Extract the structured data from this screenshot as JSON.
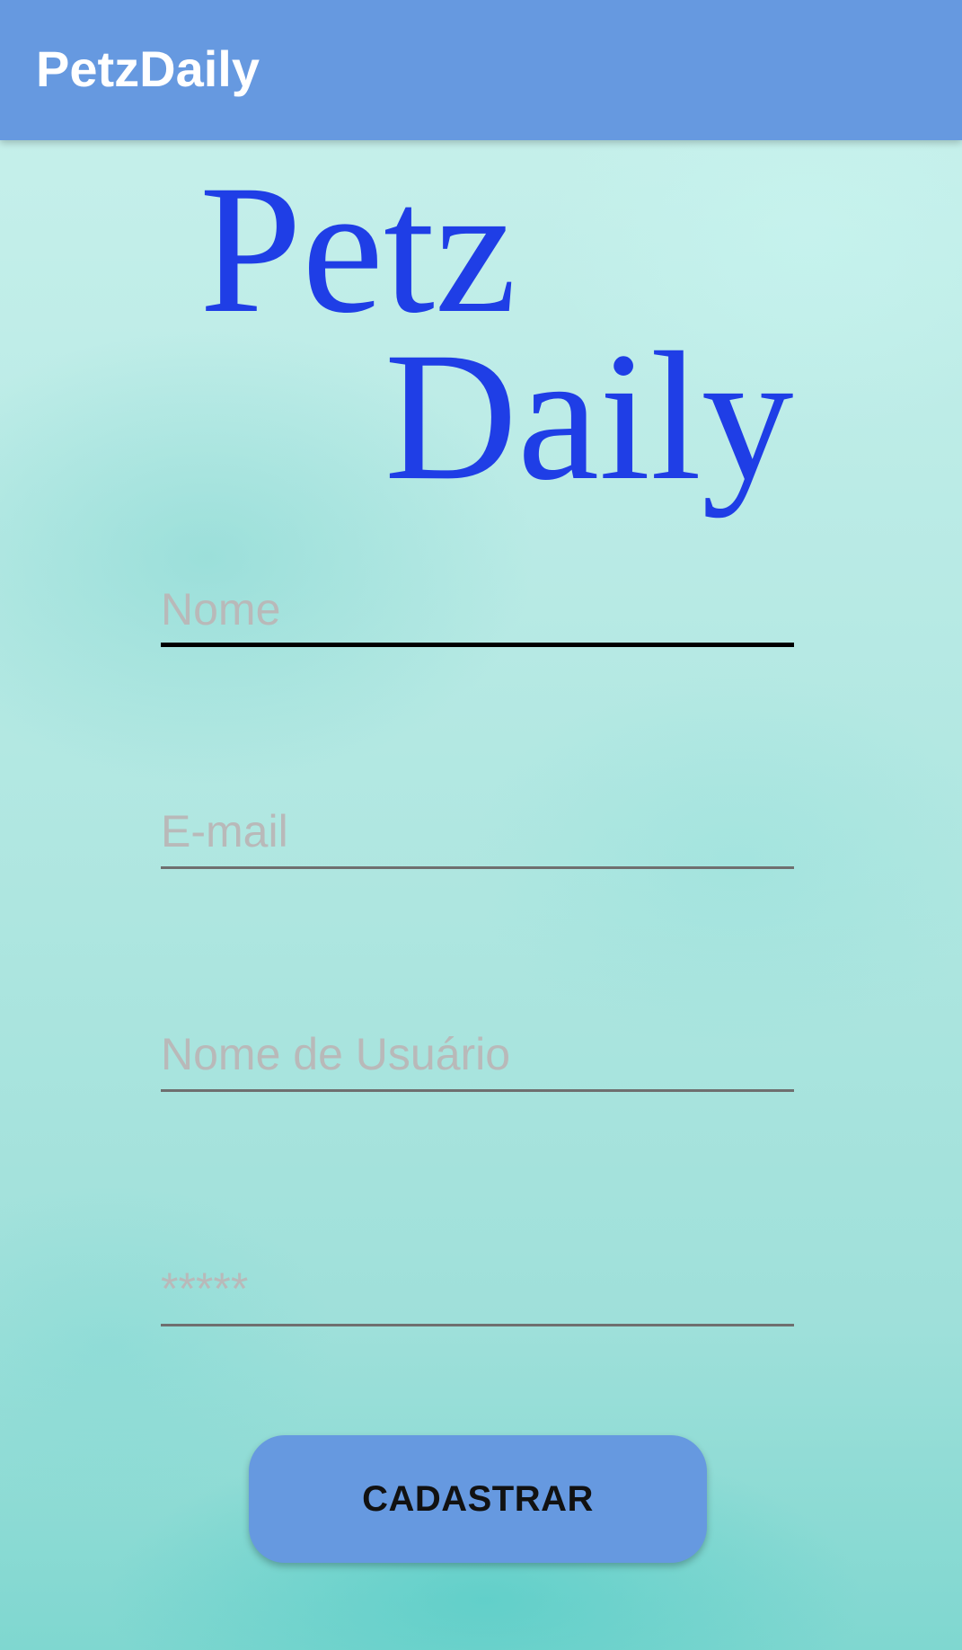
{
  "app_bar": {
    "title": "PetzDaily",
    "background_color": "#6699e0",
    "title_color": "#ffffff"
  },
  "logo": {
    "line1": "Petz",
    "line2": "Daily",
    "color": "#1f3ee6"
  },
  "form": {
    "name_field": {
      "placeholder": "Nome",
      "value": ""
    },
    "email_field": {
      "placeholder": "E-mail",
      "value": ""
    },
    "username_field": {
      "placeholder": "Nome de Usuário",
      "value": ""
    },
    "password_field": {
      "placeholder": "*****",
      "value": ""
    }
  },
  "submit_button": {
    "label": "CADASTRAR",
    "background_color": "#6699e0"
  }
}
